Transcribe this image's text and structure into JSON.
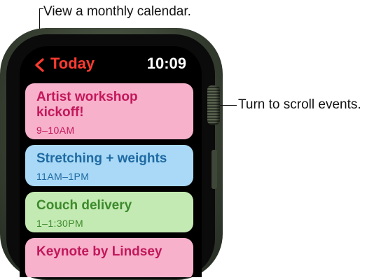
{
  "callouts": {
    "top": "View a monthly calendar.",
    "right": "Turn to scroll events."
  },
  "watch": {
    "back_label": "Today",
    "back_icon": "chevron-left-icon",
    "time": "10:09",
    "accent_color": "#ff3b30"
  },
  "events": [
    {
      "title": "Artist workshop kickoff!",
      "time": "9–10AM",
      "color": "#f7b1cb"
    },
    {
      "title": "Stretching + weights",
      "time": "11AM–1PM",
      "color": "#a9d9f6"
    },
    {
      "title": "Couch delivery",
      "time": "1–1:30PM",
      "color": "#c4eab3"
    },
    {
      "title": "Keynote by Lindsey",
      "time": "",
      "color": "#f7b1cb"
    }
  ]
}
